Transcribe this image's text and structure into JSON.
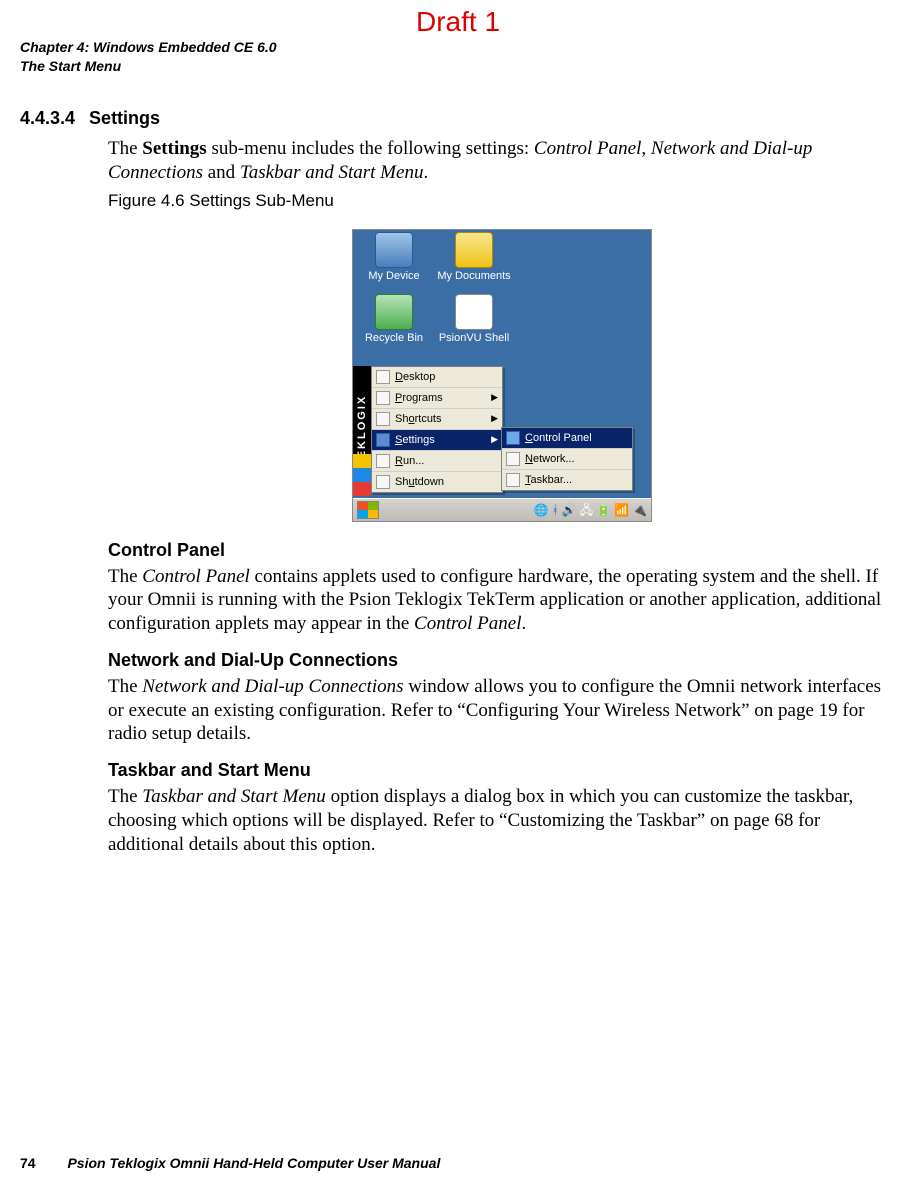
{
  "draft_label": "Draft 1",
  "header": {
    "line1": "Chapter 4: Windows Embedded CE 6.0",
    "line2": "The Start Menu"
  },
  "section": {
    "number": "4.4.3.4",
    "title": "Settings",
    "intro_pre": "The ",
    "intro_bold": "Settings",
    "intro_mid": " sub-menu includes the following settings: ",
    "intro_i1": "Control Panel",
    "intro_sep1": ", ",
    "intro_i2": "Network and Dial-up Connections",
    "intro_sep2": " and ",
    "intro_i3": "Taskbar and Start Menu",
    "intro_end": ".",
    "figure_caption": "Figure 4.6  Settings Sub-Menu"
  },
  "screenshot": {
    "desktop_icons": {
      "my_device": "My Device",
      "my_documents": "My Documents",
      "recycle_bin": "Recycle Bin",
      "psionvu_shell": "PsionVU Shell"
    },
    "tek_strip": "TEKLOGIX",
    "start_menu": {
      "desktop": "Desktop",
      "programs": "Programs",
      "shortcuts": "Shortcuts",
      "settings": "Settings",
      "run": "Run...",
      "shutdown": "Shutdown"
    },
    "sub_menu": {
      "control_panel": "Control Panel",
      "network": "Network...",
      "taskbar": "Taskbar..."
    }
  },
  "cp": {
    "heading": "Control Panel",
    "p_pre": "The ",
    "p_i": "Control Panel",
    "p_mid": " contains applets used to configure hardware, the operating system and the shell. If your Omnii is running with the Psion Teklogix TekTerm application or another application, additional configuration applets may appear in the ",
    "p_i2": "Control Panel",
    "p_end": "."
  },
  "net": {
    "heading": "Network and Dial-Up Connections",
    "p_pre": "The ",
    "p_i": "Network and Dial-up Connections",
    "p_rest": " window allows you to configure the Omnii network interfaces or execute an existing configuration. Refer to “Configuring Your Wireless Network” on page 19 for radio setup details."
  },
  "tb": {
    "heading": "Taskbar and Start Menu",
    "p_pre": "The ",
    "p_i": "Taskbar and Start Menu",
    "p_rest": " option displays a dialog box in which you can customize the taskbar, choosing which options will be displayed. Refer to “Customizing the Taskbar” on page 68 for additional details about this option."
  },
  "footer": {
    "page": "74",
    "title": "Psion Teklogix Omnii Hand-Held Computer User Manual"
  }
}
